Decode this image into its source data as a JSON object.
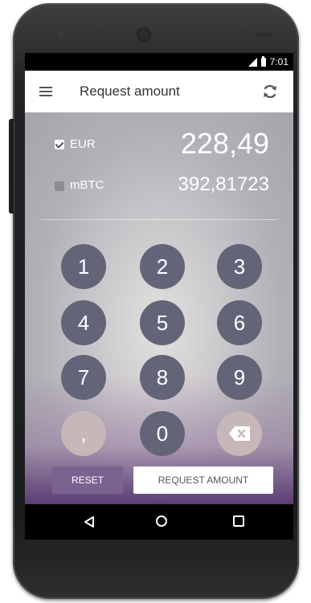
{
  "statusbar": {
    "time": "7:01"
  },
  "appbar": {
    "title": "Request amount",
    "menu_icon": "hamburger-menu-icon",
    "refresh_icon": "sync-icon"
  },
  "currencies": [
    {
      "label": "EUR",
      "value": "228,49",
      "checked": true
    },
    {
      "label": "mBTC",
      "value": "392,81723",
      "checked": false
    }
  ],
  "keypad": {
    "keys": [
      "1",
      "2",
      "3",
      "4",
      "5",
      "6",
      "7",
      "8",
      "9",
      ",",
      "0"
    ],
    "backspace_icon": "backspace-icon"
  },
  "actions": {
    "reset_label": "RESET",
    "request_label": "REQUEST AMOUNT"
  },
  "colors": {
    "key": "#646479",
    "key_light": "#c7b7b8",
    "reset_button": "#7b6390"
  }
}
